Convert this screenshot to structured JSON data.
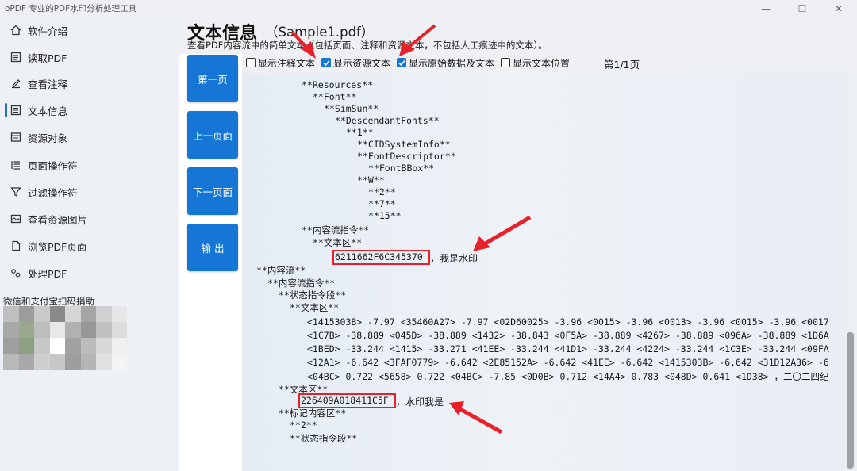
{
  "window": {
    "title": "oPDF 专业的PDF水印分析处理工具",
    "minimize": "—",
    "maximize": "☐",
    "close": "✕"
  },
  "sidebar": {
    "items": [
      {
        "label": "软件介绍",
        "icon": "home-icon"
      },
      {
        "label": "读取PDF",
        "icon": "read-icon"
      },
      {
        "label": "查看注释",
        "icon": "annotation-icon"
      },
      {
        "label": "文本信息",
        "icon": "text-info-icon",
        "active": true
      },
      {
        "label": "资源对象",
        "icon": "resource-icon"
      },
      {
        "label": "页面操作符",
        "icon": "operator-list-icon"
      },
      {
        "label": "过滤操作符",
        "icon": "filter-icon"
      },
      {
        "label": "查看资源图片",
        "icon": "image-icon"
      },
      {
        "label": "浏览PDF页面",
        "icon": "page-icon"
      },
      {
        "label": "处理PDF",
        "icon": "process-icon"
      }
    ],
    "donate_label": "微信和支付宝扫码捐助"
  },
  "header": {
    "title": "文本信息",
    "file": "（Sample1.pdf）",
    "description": "查看PDF内容流中的简单文本（包括页面、注释和资源文本，不包括人工痕迹中的文本）。"
  },
  "buttons": {
    "first": "第一页",
    "prev": "上一页面",
    "next": "下一页面",
    "export": "输 出"
  },
  "options": [
    {
      "label": "显示注释文本",
      "checked": false
    },
    {
      "label": "显示资源文本",
      "checked": true
    },
    {
      "label": "显示原始数据及文本",
      "checked": true
    },
    {
      "label": "显示文本位置",
      "checked": false
    }
  ],
  "page_indicator": "第1/1页",
  "tree_lines": [
    "**Resources**",
    "**Font**",
    "**SimSun**",
    "**DescendantFonts**",
    "**1**",
    "**CIDSystemInfo**",
    "**FontDescriptor**",
    "**FontBBox**",
    "**W**",
    "**2**",
    "**7**",
    "**15**",
    "**内容流指令**",
    "**文本区**",
    "6211662F6C345370",
    "，我是水印",
    "**内容流**",
    "**内容流指令**",
    "**状态指令段**",
    "**文本区**",
    "<1415303B> -7.97 <35460A27> -7.97 <02D60025> -3.96 <0015> -3.96 <0013> -3.96 <0015> -3.96 <0017",
    "<1C7B> -38.889 <045D> -38.889 <1432> -38.843 <0F5A> -38.889 <4267> -38.889 <096A> -38.889 <1D6A",
    "<1BED> -33.244 <1415> -33.271 <41EE> -33.244 <41D1> -33.244 <4224> -33.244 <1C3E> -33.244 <09FA",
    "<12A1> -6.642 <3FAF0779> -6.642 <2E85152A> -6.642 <41EE> -6.642 <1415303B> -6.642 <31D12A36> -6",
    "<04BC> 0.722 <5658> 0.722 <04BC> -7.85 <0D0B> 0.712 <14A4> 0.783 <048D> 0.641 <1D38> ，二〇二四纪",
    "**文本区**",
    "226409A018411C5F",
    "，水印我是",
    "**标记内容区**",
    "**2**",
    "**状态指令段**"
  ],
  "colors": {
    "accent": "#1676d6",
    "highlight": "#e8202a"
  }
}
